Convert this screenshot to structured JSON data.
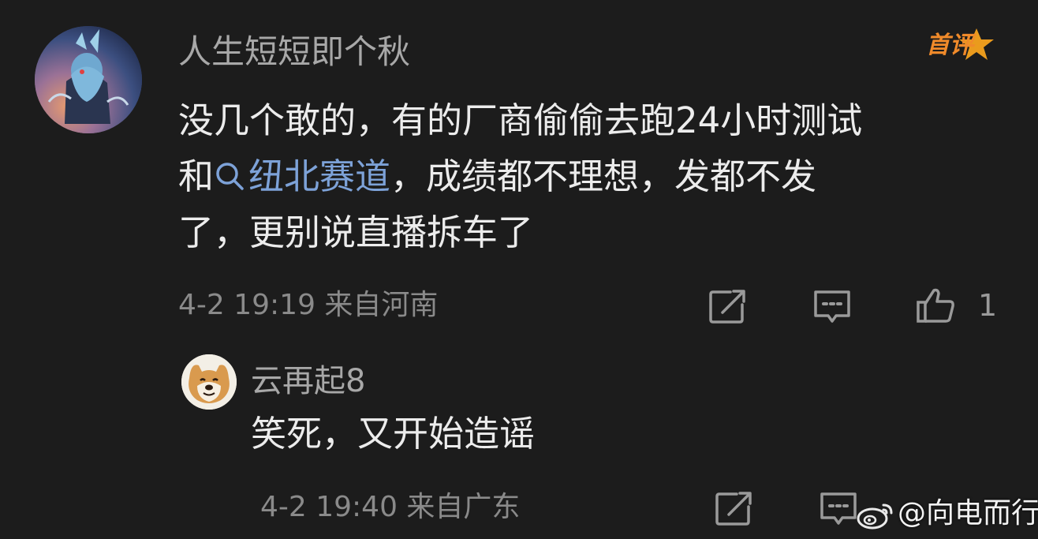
{
  "comment": {
    "username": "人生短短即个秋",
    "badge": "首评",
    "text_lines": {
      "line1": "没几个敢的，有的厂商偷偷去跑24小时测试",
      "line2_before": "和",
      "line2_topic": "纽北赛道",
      "line2_after": "，成绩都不理想，发都不发",
      "line3": "了，更别说直播拆车了"
    },
    "meta": "4-2 19:19 来自河南",
    "like_count": "1"
  },
  "reply": {
    "username": "云再起8",
    "text": "笑死，又开始造谣",
    "meta": "4-2 19:40 来自广东"
  },
  "watermark": {
    "text": "@向电而行"
  },
  "colors": {
    "background": "#1c1c1c",
    "topic_link": "#7da2d8",
    "badge": "#f08a2a"
  },
  "icons": {
    "share": "share-icon",
    "comment": "comment-icon",
    "like": "like-icon",
    "search": "search-icon",
    "weibo": "weibo-logo"
  }
}
